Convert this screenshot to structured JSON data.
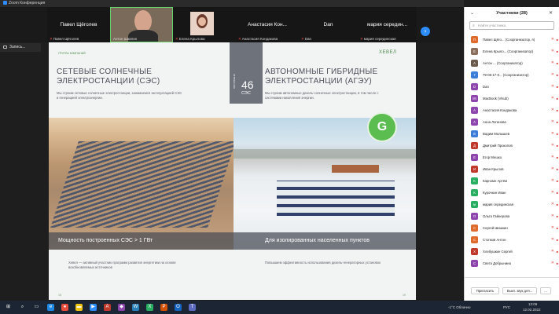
{
  "window": {
    "title": "Zoom Конференция"
  },
  "strip": {
    "tiles": [
      {
        "big": "Павел Щёголев",
        "label": "Павел Щёголев"
      },
      {
        "big": "",
        "label": "Антон Шавлин"
      },
      {
        "big": "",
        "label": "Елена Крылова"
      },
      {
        "big": "Анастасия Кон...",
        "label": "Анастасия Кондакова"
      },
      {
        "big": "Dan",
        "label": "Dan"
      },
      {
        "big": "мария середин...",
        "label": "мария серединская"
      }
    ]
  },
  "recording": {
    "label": "Запись..."
  },
  "slide": {
    "logo_left": "ГРУППА КОМПАНИЙ",
    "logo_right": "ХЕВЕЛ",
    "left_title_1": "СЕТЕВЫЕ СОЛНЕЧНЫЕ",
    "left_title_2": "ЭЛЕКТРОСТАНЦИИ (СЭС)",
    "left_desc": "Мы строим сетевые солнечные электростанции, занимаемся эксплуатацией СЭС и генерацией электроэнергии.",
    "badge_num": "46",
    "badge_unit": "СЭС",
    "badge_vert": "ПОСТРОЕНО",
    "right_title_1": "АВТОНОМНЫЕ ГИБРИДНЫЕ",
    "right_title_2": "ЭЛЕКТРОСТАНЦИИ (АГЭУ)",
    "right_desc": "Мы строим автономные дизель-солнечные электростанции, в том числе с системами накопления энергии.",
    "seal_letter": "G",
    "caption_left": "Мощность построенных СЭС > 1 ГВт",
    "caption_right": "Для изолированных населенных пунктов",
    "bottom_left": "Хевел — активный участник программ развития энергетики на основе возобновляемых источников",
    "bottom_right": "Повышаем эффективность использования дизель-генераторных установок",
    "page_left": "18",
    "page_right": "19"
  },
  "participants_panel": {
    "header": "Участники (28)",
    "search_placeholder": "Найти участника",
    "items": [
      {
        "initial": "П",
        "name": "Павел Щёго... (Соорганизатор, я)",
        "color": "#e06a2c"
      },
      {
        "initial": "Е",
        "name": "Елена Крыло... (Соорганизатор)",
        "color": "#8a6d5b"
      },
      {
        "initial": "А",
        "name": "Антон ... (Соорганизатор)",
        "color": "#6b5a4b"
      },
      {
        "initial": "7",
        "name": "79-06-17-0... (Соорганизатор)",
        "color": "#3b7dd8"
      },
      {
        "initial": "D",
        "name": "Dan",
        "color": "#8e44ad"
      },
      {
        "initial": "MI",
        "name": "MacBook (Vlsub)",
        "color": "#8e44ad"
      },
      {
        "initial": "А",
        "name": "Анастасия Кондакова",
        "color": "#8e44ad"
      },
      {
        "initial": "А",
        "name": "Анна Логинова",
        "color": "#8e44ad"
      },
      {
        "initial": "В",
        "name": "Вадим Малышев",
        "color": "#3b7dd8"
      },
      {
        "initial": "Д",
        "name": "Дмитрий Прокопов",
        "color": "#c0392b"
      },
      {
        "initial": "Е",
        "name": "Егор Мешко",
        "color": "#8e44ad"
      },
      {
        "initial": "И",
        "name": "Иван Крылов",
        "color": "#c0392b"
      },
      {
        "initial": "К",
        "name": "Карномн Артём",
        "color": "#27ae60"
      },
      {
        "initial": "К",
        "name": "Курочкин Иван",
        "color": "#27ae60"
      },
      {
        "initial": "м",
        "name": "мария серединская",
        "color": "#27ae60"
      },
      {
        "initial": "О",
        "name": "Ольга Гайнерова",
        "color": "#8e44ad"
      },
      {
        "initial": "С",
        "name": "Сергей Шишкин",
        "color": "#e06a2c"
      },
      {
        "initial": "С",
        "name": "Стопков Антон",
        "color": "#e06a2c"
      },
      {
        "initial": "Х",
        "name": "Хлебушкин Сергей",
        "color": "#c0392b"
      },
      {
        "initial": "С",
        "name": "Света Добрынина",
        "color": "#8e44ad"
      }
    ],
    "invite_label": "Пригласить",
    "mute_all_label": "Выкл. звук для...",
    "more_label": "..."
  },
  "taskbar": {
    "weather": "-1°C  Облачно",
    "lang": "РУС",
    "time": "13:09",
    "date": "12.02.2022"
  }
}
